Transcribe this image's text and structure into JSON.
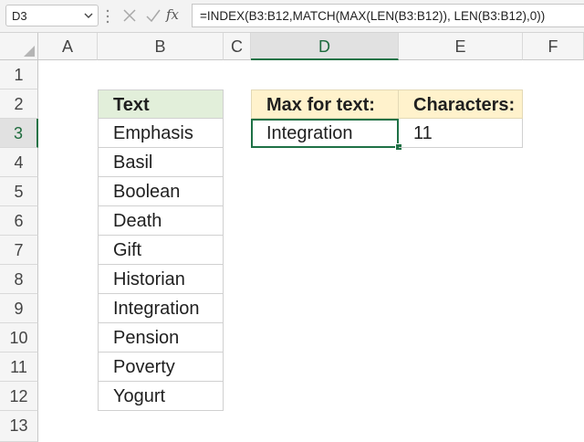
{
  "formula_bar": {
    "name_box": "D3",
    "fx_label": "fx",
    "formula": "=INDEX(B3:B12,MATCH(MAX(LEN(B3:B12)), LEN(B3:B12),0))"
  },
  "columns": [
    "A",
    "B",
    "C",
    "D",
    "E",
    "F"
  ],
  "active_column": "D",
  "rows": [
    "1",
    "2",
    "3",
    "4",
    "5",
    "6",
    "7",
    "8",
    "9",
    "10",
    "11",
    "12",
    "13"
  ],
  "active_row": "3",
  "text_list": {
    "header": "Text",
    "items": [
      "Emphasis",
      "Basil",
      "Boolean",
      "Death",
      "Gift",
      "Historian",
      "Integration",
      "Pension",
      "Poverty",
      "Yogurt"
    ]
  },
  "result": {
    "max_header": "Max for text:",
    "chars_header": "Characters:",
    "max_value": "Integration",
    "chars_value": "11"
  },
  "colors": {
    "accent_green": "#217346",
    "header_green_fill": "#e2efda",
    "header_yellow_fill": "#fff2cc"
  }
}
